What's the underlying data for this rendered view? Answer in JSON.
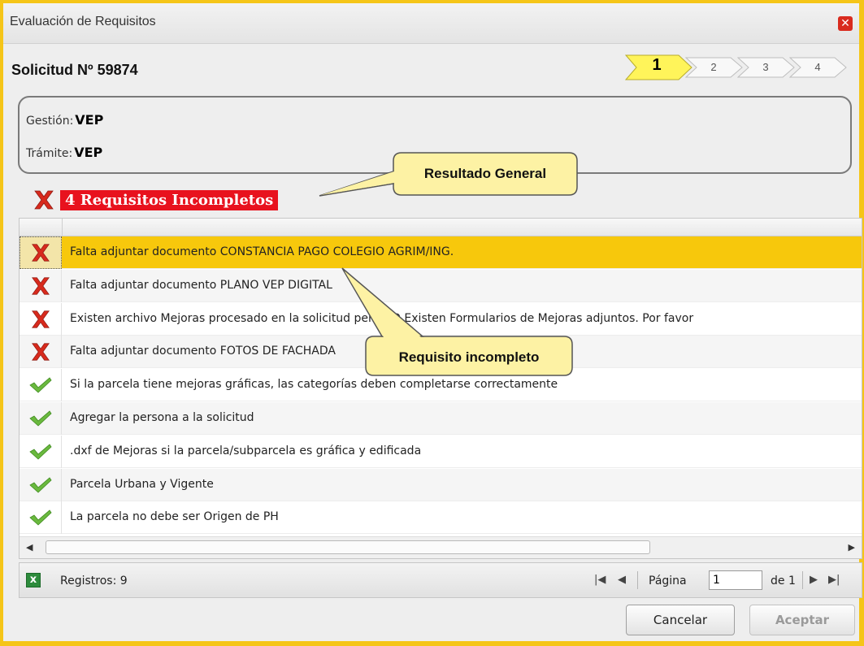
{
  "window": {
    "title": "Evaluación de Requisitos",
    "close_icon": "close-icon"
  },
  "header": {
    "solicitud": "Solicitud Nº 59874"
  },
  "steps": {
    "items": [
      "1",
      "2",
      "3",
      "4"
    ],
    "active": "1"
  },
  "info": {
    "gestion_label": "Gestión:",
    "gestion_value": "VEP",
    "tramite_label": "Trámite:",
    "tramite_value": "VEP"
  },
  "result": {
    "label": "4 Requisitos Incompletos",
    "status": "incomplete"
  },
  "callouts": {
    "general": "Resultado General",
    "incomplete": "Requisito incompleto"
  },
  "requirements": [
    {
      "status": "fail",
      "text": "Falta adjuntar documento CONSTANCIA PAGO COLEGIO AGRIM/ING."
    },
    {
      "status": "fail",
      "text": "Falta adjuntar documento PLANO VEP DIGITAL"
    },
    {
      "status": "fail",
      "text": "Existen archivo Mejoras procesado en la solicitud pero NO Existen Formularios de Mejoras adjuntos. Por favor"
    },
    {
      "status": "fail",
      "text": "Falta adjuntar documento FOTOS DE FACHADA"
    },
    {
      "status": "ok",
      "text": "Si la parcela tiene mejoras gráficas, las categorías deben completarse correctamente"
    },
    {
      "status": "ok",
      "text": "Agregar la persona a la solicitud"
    },
    {
      "status": "ok",
      "text": ".dxf de Mejoras si la parcela/subparcela es gráfica y edificada"
    },
    {
      "status": "ok",
      "text": "Parcela Urbana y Vigente"
    },
    {
      "status": "ok",
      "text": "La parcela no debe ser Origen de PH"
    }
  ],
  "pager": {
    "registros": "Registros: 9",
    "pagina_label": "Página",
    "page_value": "1",
    "of_label": "de 1"
  },
  "buttons": {
    "cancel": "Cancelar",
    "accept": "Aceptar"
  },
  "colors": {
    "border": "#f5c518",
    "selected_row": "#f7c80c",
    "fail": "#d82a1d",
    "ok": "#6ab93e",
    "result_bg": "#e8121e",
    "callout_fill": "#fdf2a4"
  }
}
